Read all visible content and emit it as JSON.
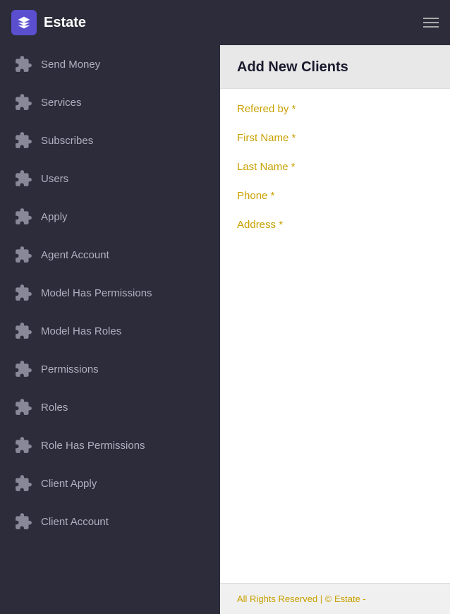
{
  "app": {
    "title": "Estate",
    "logo_symbol": "↺"
  },
  "sidebar": {
    "items": [
      {
        "id": "send-money",
        "label": "Send Money",
        "active": false
      },
      {
        "id": "services",
        "label": "Services",
        "active": false
      },
      {
        "id": "subscribes",
        "label": "Subscribes",
        "active": false
      },
      {
        "id": "users",
        "label": "Users",
        "active": false
      },
      {
        "id": "apply",
        "label": "Apply",
        "active": false
      },
      {
        "id": "agent-account",
        "label": "Agent Account",
        "active": false
      },
      {
        "id": "model-has-permissions",
        "label": "Model Has Permissions",
        "active": false
      },
      {
        "id": "model-has-roles",
        "label": "Model Has Roles",
        "active": false
      },
      {
        "id": "permissions",
        "label": "Permissions",
        "active": false
      },
      {
        "id": "roles",
        "label": "Roles",
        "active": false
      },
      {
        "id": "role-has-permissions",
        "label": "Role Has Permissions",
        "active": false
      },
      {
        "id": "client-apply",
        "label": "Client Apply",
        "active": false
      },
      {
        "id": "client-account",
        "label": "Client Account",
        "active": false
      }
    ]
  },
  "content": {
    "page_title": "Add New Clients",
    "form_fields": [
      {
        "id": "refered-by",
        "label": "Refered by *"
      },
      {
        "id": "first-name",
        "label": "First Name *"
      },
      {
        "id": "last-name",
        "label": "Last Name *"
      },
      {
        "id": "phone",
        "label": "Phone *"
      },
      {
        "id": "address",
        "label": "Address *"
      }
    ]
  },
  "footer": {
    "text": "All Rights Reserved | © Estate -"
  }
}
